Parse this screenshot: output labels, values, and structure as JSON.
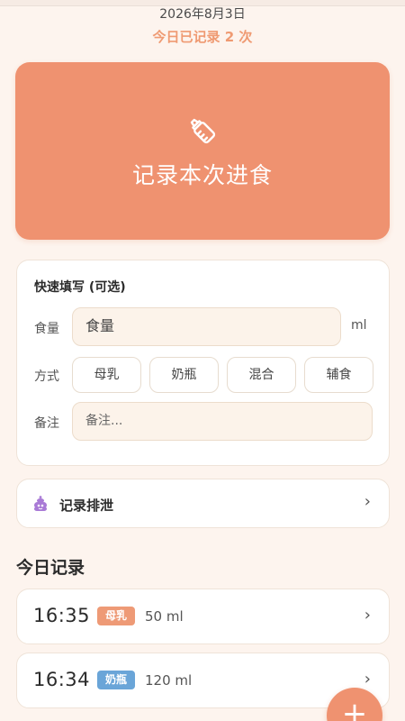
{
  "header": {
    "date": "2026年8月3日",
    "count_text": "今日已记录 2 次"
  },
  "hero": {
    "icon": "baby-bottle-icon",
    "label": "记录本次进食"
  },
  "quick_fill": {
    "title": "快速填写 (可选)",
    "amount_label": "食量",
    "amount_placeholder": "食量",
    "unit": "ml",
    "method_label": "方式",
    "methods": [
      "母乳",
      "奶瓶",
      "混合",
      "辅食"
    ],
    "note_label": "备注",
    "note_placeholder": "备注..."
  },
  "poop": {
    "icon": "poop-icon",
    "label": "记录排泄",
    "chevron": "›"
  },
  "records": {
    "title": "今日记录",
    "items": [
      {
        "time": "16:35",
        "tag": "母乳",
        "tag_color": "#ee9a76",
        "amount": "50 ml",
        "chevron": "›"
      },
      {
        "time": "16:34",
        "tag": "奶瓶",
        "tag_color": "#6aa5d8",
        "amount": "120 ml",
        "chevron": "›"
      }
    ]
  },
  "fab": {
    "label": "+"
  },
  "colors": {
    "background": "#fdf4ee",
    "accent": "#ef9270",
    "accent_text": "#ef9a72",
    "card_border": "#efe3d8"
  }
}
